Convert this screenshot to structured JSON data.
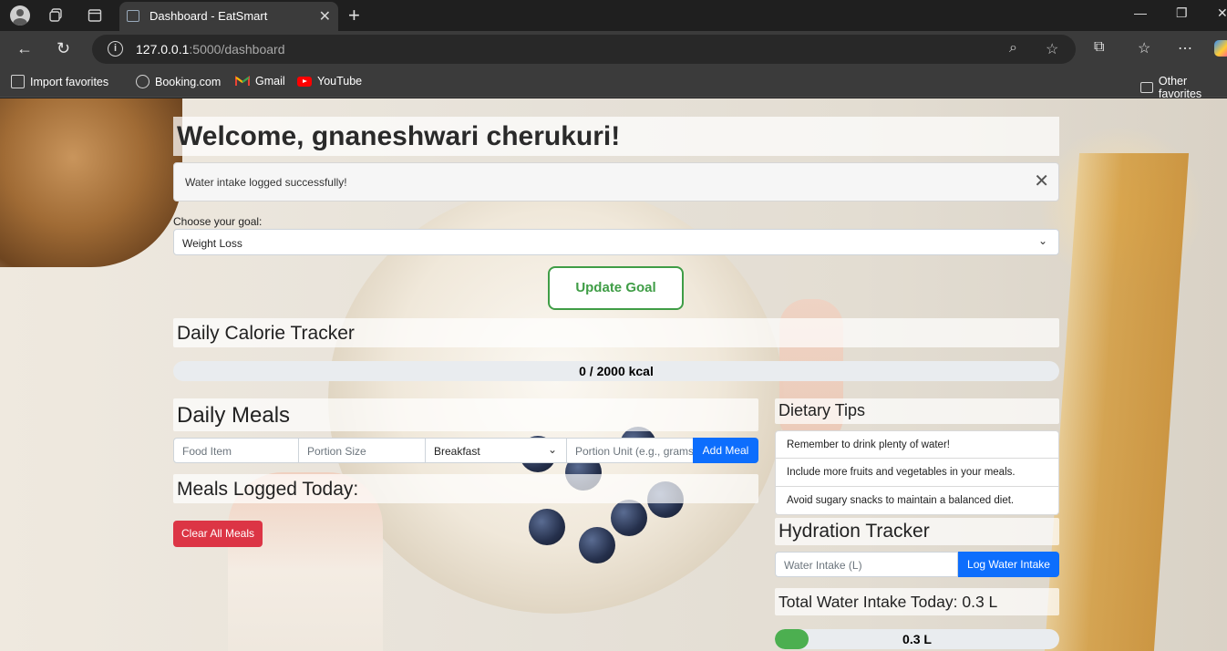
{
  "browser": {
    "tab_title": "Dashboard - EatSmart",
    "url_host": "127.0.0.1",
    "url_rest": ":5000/dashboard",
    "bookmarks": [
      {
        "label": "Import favorites",
        "icon": "import-icon"
      },
      {
        "label": "Booking.com",
        "icon": "globe-icon"
      },
      {
        "label": "Gmail",
        "icon": "gmail-icon"
      },
      {
        "label": "YouTube",
        "icon": "youtube-icon"
      }
    ],
    "other_favorites": "Other favorites"
  },
  "page": {
    "welcome": "Welcome, gnaneshwari cherukuri!",
    "alert": "Water intake logged successfully!",
    "goal_label": "Choose your goal:",
    "goal_value": "Weight Loss",
    "update_goal": "Update Goal"
  },
  "calorie": {
    "title": "Daily Calorie Tracker",
    "text": "0 / 2000 kcal",
    "consumed": 0,
    "goal": 2000
  },
  "meals": {
    "title": "Daily Meals",
    "food_placeholder": "Food Item",
    "portion_placeholder": "Portion Size",
    "meal_type": "Breakfast",
    "unit_placeholder": "Portion Unit (e.g., grams)",
    "add_label": "Add Meal",
    "logged_title": "Meals Logged Today:",
    "clear_label": "Clear All Meals"
  },
  "tips": {
    "title": "Dietary Tips",
    "items": [
      "Remember to drink plenty of water!",
      "Include more fruits and vegetables in your meals.",
      "Avoid sugary snacks to maintain a balanced diet."
    ]
  },
  "hydration": {
    "title": "Hydration Tracker",
    "input_placeholder": "Water Intake (L)",
    "log_label": "Log Water Intake",
    "total_text": "Total Water Intake Today: 0.3 L",
    "bar_text": "0.3 L",
    "progress_fraction": 0.12
  },
  "colors": {
    "accent_blue": "#0d6efd",
    "success_green": "#4caf50",
    "danger_red": "#dc3545"
  }
}
